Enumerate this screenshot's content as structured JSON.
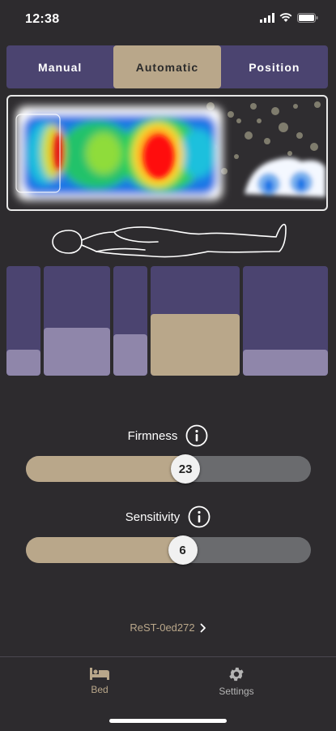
{
  "status_bar": {
    "time": "12:38"
  },
  "mode_tabs": [
    {
      "label": "Manual",
      "active": false
    },
    {
      "label": "Automatic",
      "active": true
    },
    {
      "label": "Position",
      "active": false
    }
  ],
  "zones": [
    {
      "level": 0.24,
      "selected": false
    },
    {
      "level": 0.44,
      "selected": false
    },
    {
      "level": 0.38,
      "selected": false
    },
    {
      "level": 0.56,
      "selected": true
    },
    {
      "level": 0.24,
      "selected": false
    }
  ],
  "firmness": {
    "label": "Firmness",
    "value": "23",
    "level": 0.56
  },
  "sensitivity": {
    "label": "Sensitivity",
    "value": "6",
    "level": 0.55
  },
  "device": {
    "name": "ReST-0ed272"
  },
  "bottom_nav": [
    {
      "label": "Bed",
      "icon": "bed-icon",
      "active": true
    },
    {
      "label": "Settings",
      "icon": "gear-icon",
      "active": false
    }
  ],
  "colors": {
    "accent": "#b9a78a",
    "purple": "#4b4470",
    "zone_fill": "#8f86aa",
    "background": "#2d2b2e"
  }
}
